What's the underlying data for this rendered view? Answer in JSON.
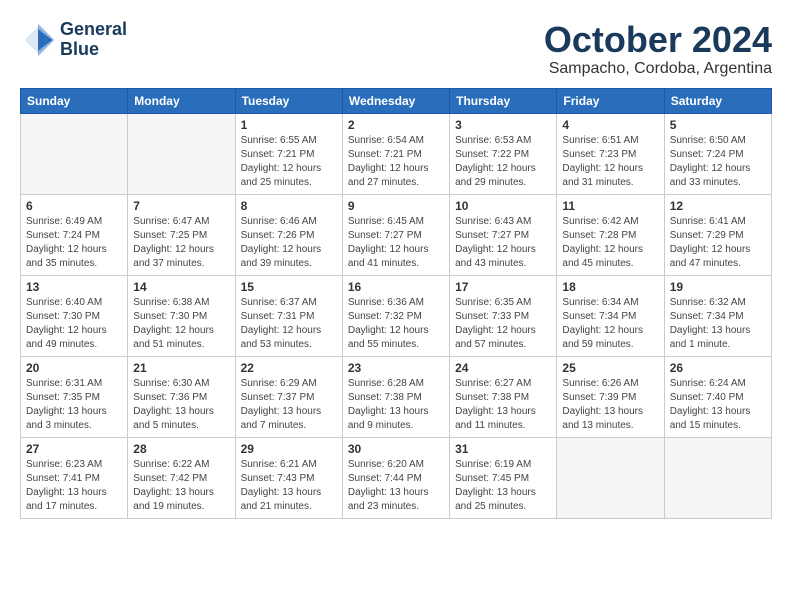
{
  "header": {
    "logo_line1": "General",
    "logo_line2": "Blue",
    "month_title": "October 2024",
    "location": "Sampacho, Cordoba, Argentina"
  },
  "weekdays": [
    "Sunday",
    "Monday",
    "Tuesday",
    "Wednesday",
    "Thursday",
    "Friday",
    "Saturday"
  ],
  "weeks": [
    [
      {
        "day": "",
        "info": ""
      },
      {
        "day": "",
        "info": ""
      },
      {
        "day": "1",
        "info": "Sunrise: 6:55 AM\nSunset: 7:21 PM\nDaylight: 12 hours\nand 25 minutes."
      },
      {
        "day": "2",
        "info": "Sunrise: 6:54 AM\nSunset: 7:21 PM\nDaylight: 12 hours\nand 27 minutes."
      },
      {
        "day": "3",
        "info": "Sunrise: 6:53 AM\nSunset: 7:22 PM\nDaylight: 12 hours\nand 29 minutes."
      },
      {
        "day": "4",
        "info": "Sunrise: 6:51 AM\nSunset: 7:23 PM\nDaylight: 12 hours\nand 31 minutes."
      },
      {
        "day": "5",
        "info": "Sunrise: 6:50 AM\nSunset: 7:24 PM\nDaylight: 12 hours\nand 33 minutes."
      }
    ],
    [
      {
        "day": "6",
        "info": "Sunrise: 6:49 AM\nSunset: 7:24 PM\nDaylight: 12 hours\nand 35 minutes."
      },
      {
        "day": "7",
        "info": "Sunrise: 6:47 AM\nSunset: 7:25 PM\nDaylight: 12 hours\nand 37 minutes."
      },
      {
        "day": "8",
        "info": "Sunrise: 6:46 AM\nSunset: 7:26 PM\nDaylight: 12 hours\nand 39 minutes."
      },
      {
        "day": "9",
        "info": "Sunrise: 6:45 AM\nSunset: 7:27 PM\nDaylight: 12 hours\nand 41 minutes."
      },
      {
        "day": "10",
        "info": "Sunrise: 6:43 AM\nSunset: 7:27 PM\nDaylight: 12 hours\nand 43 minutes."
      },
      {
        "day": "11",
        "info": "Sunrise: 6:42 AM\nSunset: 7:28 PM\nDaylight: 12 hours\nand 45 minutes."
      },
      {
        "day": "12",
        "info": "Sunrise: 6:41 AM\nSunset: 7:29 PM\nDaylight: 12 hours\nand 47 minutes."
      }
    ],
    [
      {
        "day": "13",
        "info": "Sunrise: 6:40 AM\nSunset: 7:30 PM\nDaylight: 12 hours\nand 49 minutes."
      },
      {
        "day": "14",
        "info": "Sunrise: 6:38 AM\nSunset: 7:30 PM\nDaylight: 12 hours\nand 51 minutes."
      },
      {
        "day": "15",
        "info": "Sunrise: 6:37 AM\nSunset: 7:31 PM\nDaylight: 12 hours\nand 53 minutes."
      },
      {
        "day": "16",
        "info": "Sunrise: 6:36 AM\nSunset: 7:32 PM\nDaylight: 12 hours\nand 55 minutes."
      },
      {
        "day": "17",
        "info": "Sunrise: 6:35 AM\nSunset: 7:33 PM\nDaylight: 12 hours\nand 57 minutes."
      },
      {
        "day": "18",
        "info": "Sunrise: 6:34 AM\nSunset: 7:34 PM\nDaylight: 12 hours\nand 59 minutes."
      },
      {
        "day": "19",
        "info": "Sunrise: 6:32 AM\nSunset: 7:34 PM\nDaylight: 13 hours\nand 1 minute."
      }
    ],
    [
      {
        "day": "20",
        "info": "Sunrise: 6:31 AM\nSunset: 7:35 PM\nDaylight: 13 hours\nand 3 minutes."
      },
      {
        "day": "21",
        "info": "Sunrise: 6:30 AM\nSunset: 7:36 PM\nDaylight: 13 hours\nand 5 minutes."
      },
      {
        "day": "22",
        "info": "Sunrise: 6:29 AM\nSunset: 7:37 PM\nDaylight: 13 hours\nand 7 minutes."
      },
      {
        "day": "23",
        "info": "Sunrise: 6:28 AM\nSunset: 7:38 PM\nDaylight: 13 hours\nand 9 minutes."
      },
      {
        "day": "24",
        "info": "Sunrise: 6:27 AM\nSunset: 7:38 PM\nDaylight: 13 hours\nand 11 minutes."
      },
      {
        "day": "25",
        "info": "Sunrise: 6:26 AM\nSunset: 7:39 PM\nDaylight: 13 hours\nand 13 minutes."
      },
      {
        "day": "26",
        "info": "Sunrise: 6:24 AM\nSunset: 7:40 PM\nDaylight: 13 hours\nand 15 minutes."
      }
    ],
    [
      {
        "day": "27",
        "info": "Sunrise: 6:23 AM\nSunset: 7:41 PM\nDaylight: 13 hours\nand 17 minutes."
      },
      {
        "day": "28",
        "info": "Sunrise: 6:22 AM\nSunset: 7:42 PM\nDaylight: 13 hours\nand 19 minutes."
      },
      {
        "day": "29",
        "info": "Sunrise: 6:21 AM\nSunset: 7:43 PM\nDaylight: 13 hours\nand 21 minutes."
      },
      {
        "day": "30",
        "info": "Sunrise: 6:20 AM\nSunset: 7:44 PM\nDaylight: 13 hours\nand 23 minutes."
      },
      {
        "day": "31",
        "info": "Sunrise: 6:19 AM\nSunset: 7:45 PM\nDaylight: 13 hours\nand 25 minutes."
      },
      {
        "day": "",
        "info": ""
      },
      {
        "day": "",
        "info": ""
      }
    ]
  ]
}
